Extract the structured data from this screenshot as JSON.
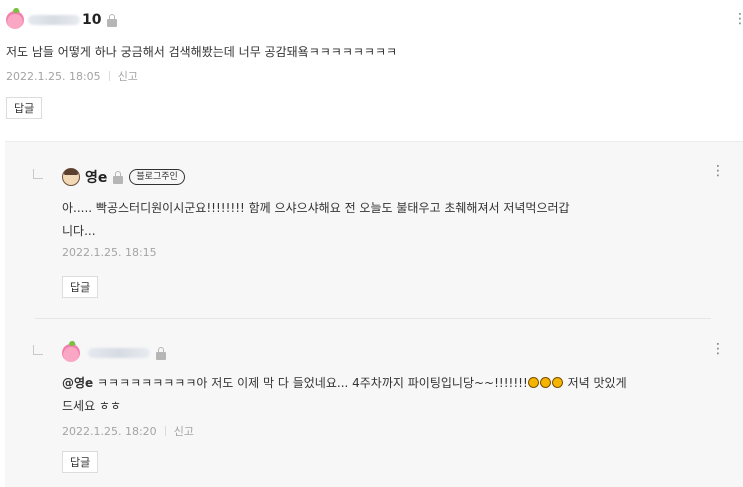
{
  "top_comment": {
    "author_suffix": "10",
    "text": "저도 남들 어떻게 하나 궁금해서 검색해봤는데 너무 공감돼욬ㅋㅋㅋㅋㅋㅋㅋㅋ",
    "date": "2022.1.25. 18:05",
    "report_label": "신고",
    "reply_label": "답글",
    "more_icon": "⋮"
  },
  "replies": [
    {
      "nickname": "영e",
      "badge": "블로그주인",
      "text_line1": "아..... 빡공스터디원이시군요!!!!!!!! 함께 으샤으샤해요 전 오늘도 불태우고 초췌해져서 저녁먹으러갑",
      "text_line2": "니다...",
      "date": "2022.1.25. 18:15",
      "reply_label": "답글",
      "more_icon": "⋮"
    },
    {
      "mention": "@영e",
      "text_part1": " ㅋㅋㅋㅋㅋㅋㅋㅋㅋ아 저도 이제 막 다 들었네요... 4주차까지 파이팅입니당~~!!!!!!!",
      "text_part2": " 저녁 맛있게",
      "text_line2": "드세요 ㅎㅎ",
      "date": "2022.1.25. 18:20",
      "report_label": "신고",
      "reply_label": "답글",
      "more_icon": "⋮"
    }
  ]
}
